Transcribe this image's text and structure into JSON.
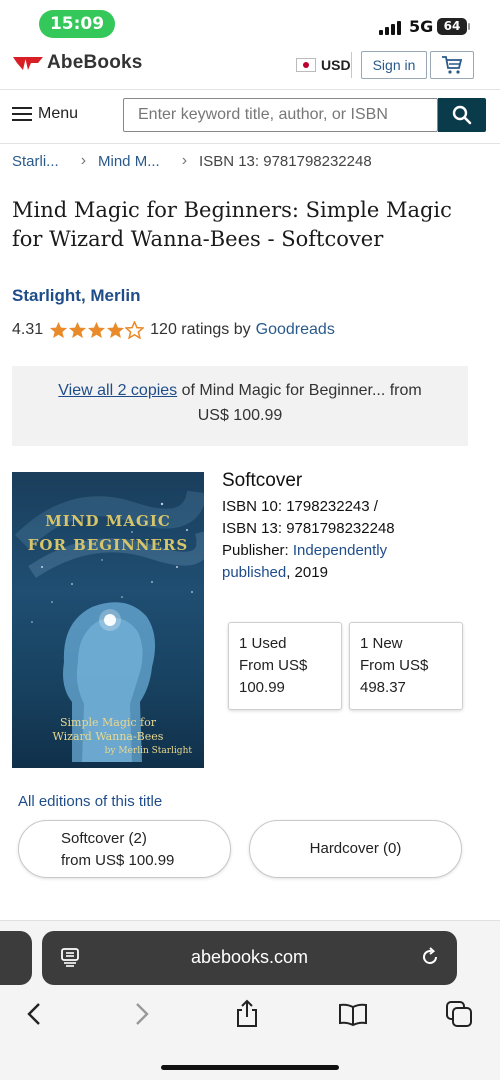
{
  "status_bar": {
    "time": "15:09",
    "network": "5G",
    "battery": "64"
  },
  "header": {
    "logo_text": "AbeBooks",
    "currency": "USD",
    "sign_in": "Sign in"
  },
  "search": {
    "menu_label": "Menu",
    "placeholder": "Enter keyword title, author, or ISBN"
  },
  "breadcrumb": {
    "items": [
      "Starli...",
      "Mind M..."
    ],
    "current": "ISBN 13: 9781798232248"
  },
  "book": {
    "title": "Mind Magic for Beginners: Simple Magic for Wizard Wanna-Bees - Softcover",
    "author": "Starlight, Merlin",
    "rating": "4.31",
    "stars": 4.31,
    "ratings_count": "120 ratings by",
    "ratings_source": "Goodreads"
  },
  "copies": {
    "link": "View all 2 copies",
    "rest_line1": " of Mind Magic for Beginner... from",
    "line2": "US$ 100.99"
  },
  "cover": {
    "title_line1": "MIND MAGIC",
    "title_line2": "FOR BEGINNERS",
    "subtitle_line1": "Simple Magic for",
    "subtitle_line2": "Wizard Wanna-Bees",
    "by": "by Merlin Starlight"
  },
  "details": {
    "binding": "Softcover",
    "isbn10": "ISBN 10: 1798232243 /",
    "isbn13": "ISBN 13: 9781798232248",
    "publisher_label": "Publisher: ",
    "publisher_line1": "Independently",
    "publisher_line2": "published",
    "year": ", 2019"
  },
  "offers": [
    {
      "line1": "1 Used",
      "line2": "From US$",
      "line3": "100.99"
    },
    {
      "line1": "1 New",
      "line2": "From US$",
      "line3": "498.37"
    }
  ],
  "editions": {
    "label": "All editions of this title",
    "softcover_line1": "Softcover (2)",
    "softcover_line2": "from US$ 100.99",
    "hardcover": "Hardcover (0)"
  },
  "browser": {
    "url": "abebooks.com"
  },
  "colors": {
    "accent": "#1f4d8a",
    "search_button": "#0a3b4a",
    "logo_red": "#d91f26",
    "star": "#e98a2b"
  }
}
